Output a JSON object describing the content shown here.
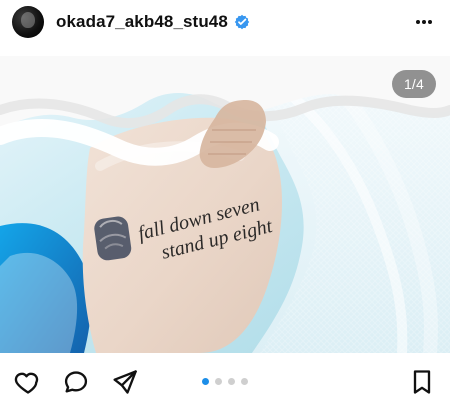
{
  "post": {
    "username": "okada7_akb48_stu48",
    "verified": true,
    "counter": "1/4",
    "carousel": {
      "count": 4,
      "active_index": 0
    }
  },
  "photo": {
    "tattoo_text_line1": "fall down seven",
    "tattoo_text_line2": "stand up eight"
  },
  "icons": {
    "avatar": "avatar",
    "verified": "verified-badge-icon",
    "more": "more-options-icon",
    "like": "heart-icon",
    "comment": "comment-icon",
    "share": "send-icon",
    "save": "bookmark-icon"
  },
  "colors": {
    "accent_blue": "#1c8ee8",
    "verified_blue": "#3897f0",
    "dot_inactive": "#cfcfcf"
  }
}
